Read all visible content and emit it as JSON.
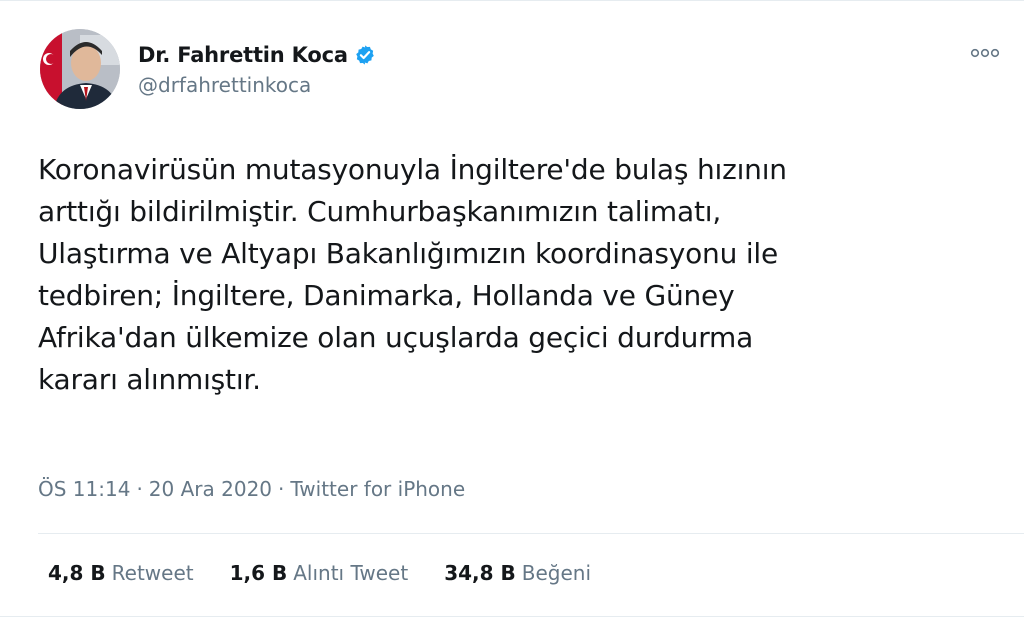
{
  "tweet": {
    "author": {
      "display_name": "Dr. Fahrettin Koca",
      "handle": "@drfahrettinkoca",
      "verified_icon": "verified-badge-icon",
      "accent": "#1da1f2"
    },
    "text_lines": [
      "Koronavirüsün mutasyonuyla İngiltere'de bulaş hızının",
      "arttığı bildirilmiştir. Cumhurbaşkanımızın talimatı,",
      "Ulaştırma ve Altyapı Bakanlığımızın koordinasyonu ile",
      "tedbiren; İngiltere, Danimarka, Hollanda ve Güney",
      "Afrika'dan ülkemize olan uçuşlarda geçici durdurma",
      "kararı alınmıştır."
    ],
    "meta": {
      "time": "ÖS 11:14",
      "separator": "·",
      "date": "20 Ara 2020",
      "source": "Twitter for iPhone"
    },
    "stats": [
      {
        "count": "4,8 B",
        "label": "Retweet"
      },
      {
        "count": "1,6 B",
        "label": "Alıntı Tweet"
      },
      {
        "count": "34,8 B",
        "label": "Beğeni"
      }
    ],
    "more_icon": "more-options-icon"
  }
}
